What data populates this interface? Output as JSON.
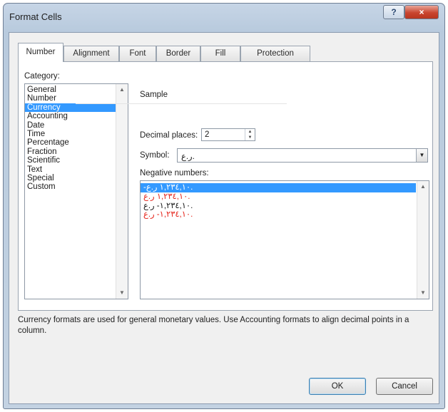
{
  "window": {
    "title": "Format Cells",
    "help_icon": "?",
    "close_icon": "×"
  },
  "tabs": [
    {
      "label": "Number",
      "active": true
    },
    {
      "label": "Alignment"
    },
    {
      "label": "Font"
    },
    {
      "label": "Border"
    },
    {
      "label": "Fill"
    },
    {
      "label": "Protection"
    }
  ],
  "category": {
    "label": "Category:",
    "items": [
      "General",
      "Number",
      "Currency",
      "Accounting",
      "Date",
      "Time",
      "Percentage",
      "Fraction",
      "Scientific",
      "Text",
      "Special",
      "Custom"
    ],
    "selected": "Currency"
  },
  "sample": {
    "label": "Sample",
    "value": ""
  },
  "decimal_places": {
    "label": "Decimal places:",
    "value": "2"
  },
  "symbol": {
    "label": "Symbol:",
    "value": "ر.ع."
  },
  "negative_numbers": {
    "label": "Negative numbers:",
    "items": [
      {
        "text": "-١,٢٣٤,١٠ ر.ع.",
        "color": "#ffffff",
        "selected": true
      },
      {
        "text": "١,٢٣٤,١٠ ر.ع.",
        "color": "#e5241a"
      },
      {
        "text": "١,٢٣٤,١٠- ر.ع.",
        "color": "#1a1a1a"
      },
      {
        "text": "١,٢٣٤,١٠- ر.ع.",
        "color": "#e5241a"
      }
    ]
  },
  "description": "Currency formats are used for general monetary values.  Use Accounting formats to align decimal points in a column.",
  "buttons": {
    "ok": "OK",
    "cancel": "Cancel"
  },
  "colors": {
    "selection": "#3399ff",
    "negative_red": "#e5241a",
    "close_red": "#c9452f"
  }
}
